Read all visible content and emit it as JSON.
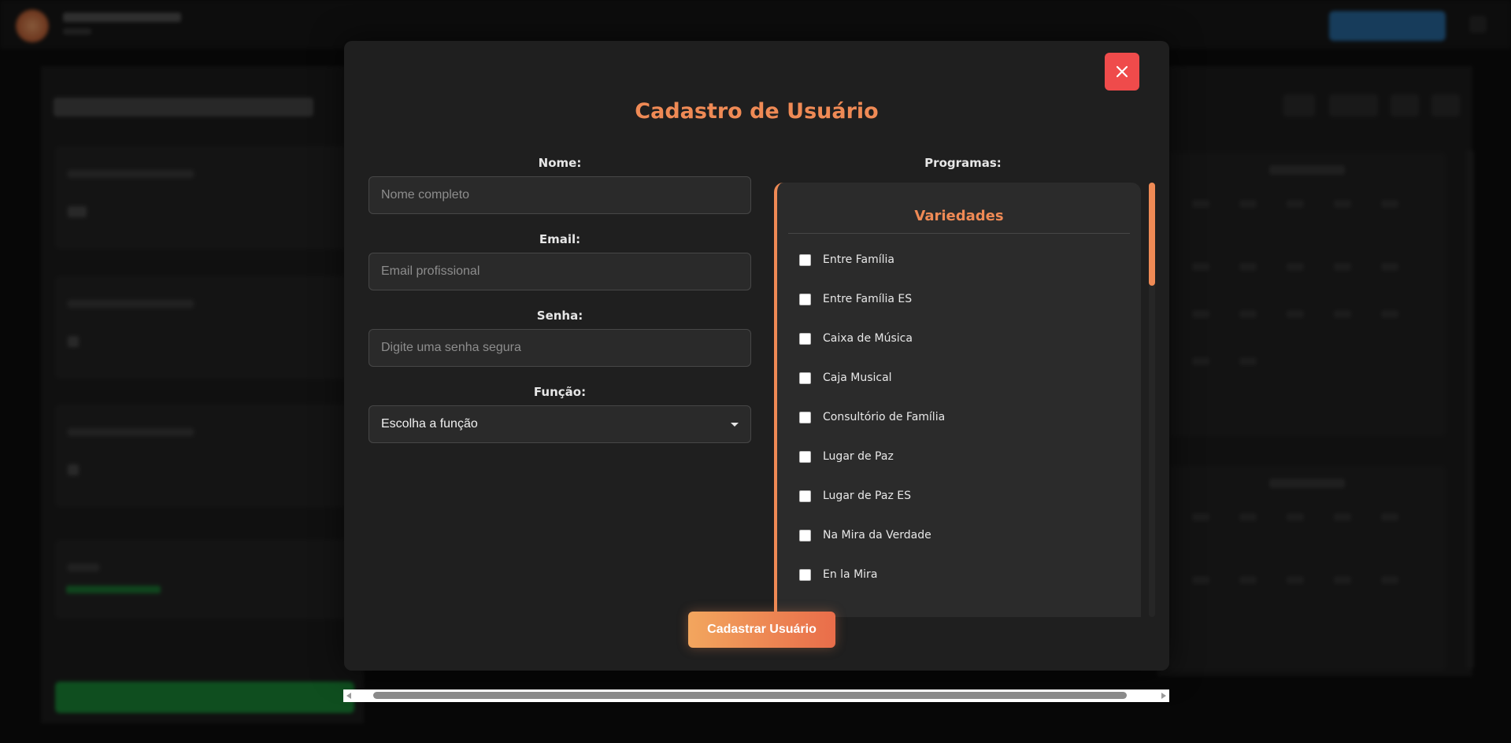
{
  "modal": {
    "title": "Cadastro de Usuário",
    "close_icon": "close-icon",
    "fields": {
      "name": {
        "label": "Nome:",
        "placeholder": "Nome completo",
        "value": ""
      },
      "email": {
        "label": "Email:",
        "placeholder": "Email profissional",
        "value": ""
      },
      "password": {
        "label": "Senha:",
        "placeholder": "Digite uma senha segura",
        "value": ""
      },
      "role": {
        "label": "Função:",
        "selected": "Escolha a função"
      }
    },
    "programs": {
      "label": "Programas:",
      "group_title": "Variedades",
      "items": [
        {
          "label": "Entre Família",
          "checked": false
        },
        {
          "label": "Entre Família ES",
          "checked": false
        },
        {
          "label": "Caixa de Música",
          "checked": false
        },
        {
          "label": "Caja Musical",
          "checked": false
        },
        {
          "label": "Consultório de Família",
          "checked": false
        },
        {
          "label": "Lugar de Paz",
          "checked": false
        },
        {
          "label": "Lugar de Paz ES",
          "checked": false
        },
        {
          "label": "Na Mira da Verdade",
          "checked": false
        },
        {
          "label": "En la Mira",
          "checked": false
        }
      ]
    },
    "submit_label": "Cadastrar Usuário"
  },
  "colors": {
    "accent": "#ef8a55",
    "close_button": "#ef4b4b",
    "modal_bg": "#1f1f1f",
    "input_bg": "#2a2a2a"
  }
}
